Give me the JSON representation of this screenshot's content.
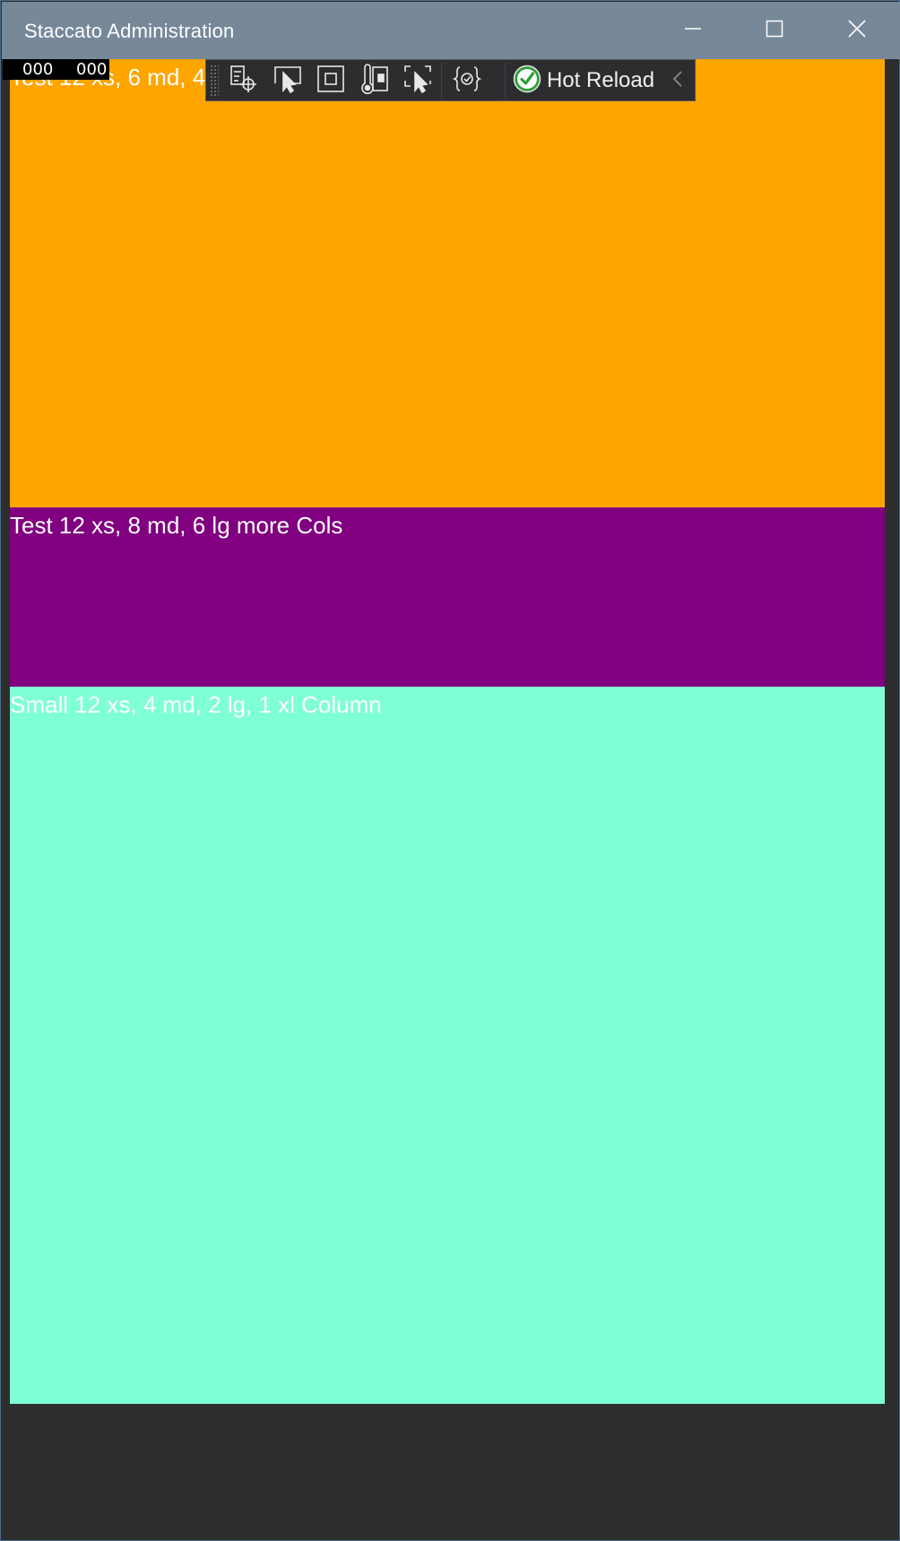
{
  "window": {
    "title": "Staccato Administration",
    "colors": {
      "titlebar": "#778899",
      "background": "#2d2d2d"
    }
  },
  "caption_buttons": {
    "minimize_icon": "minimize-icon",
    "maximize_icon": "maximize-icon",
    "close_icon": "close-icon"
  },
  "panels": [
    {
      "label": "Test 12 xs, 6 md, 4 lg, 2 xl Column",
      "color": "#ffa500"
    },
    {
      "label": "Test 12 xs, 8 md, 6 lg more Cols",
      "color": "#800080"
    },
    {
      "label": "Small 12 xs, 4 md, 2 lg, 1 xl Column",
      "color": "#7fffd4"
    }
  ],
  "fps_counter": {
    "left_value": "000",
    "right_value": "000"
  },
  "dev_toolbar": {
    "tools": [
      {
        "icon": "live-visual-tree-icon"
      },
      {
        "icon": "select-element-icon"
      },
      {
        "icon": "display-layout-adorners-icon"
      },
      {
        "icon": "track-focus-icon"
      },
      {
        "icon": "preview-selection-icon"
      },
      {
        "icon": "binding-failures-icon"
      }
    ],
    "hot_reload": {
      "label": "Hot Reload",
      "status_icon": "check-circle-icon",
      "status_color": "#2e9e3a"
    },
    "collapse_icon": "chevron-left-icon"
  }
}
